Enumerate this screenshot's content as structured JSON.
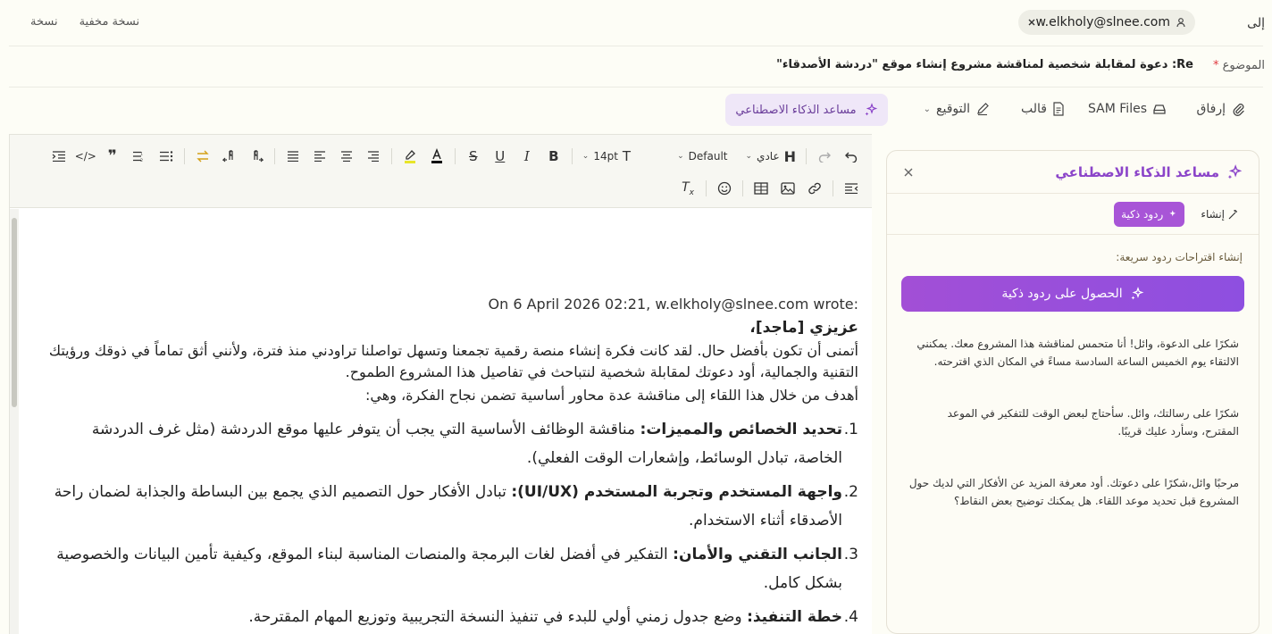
{
  "header": {
    "to_label": "إلى",
    "recipient": "w.elkholy@slnee.com",
    "cc_label": "نسخة",
    "bcc_label": "نسخة مخفية"
  },
  "subject": {
    "label": "الموضوع",
    "required_mark": "*",
    "value": "Re: دعوة لمقابلة شخصية لمناقشة مشروع إنشاء موقع \"دردشة الأصدقاء\""
  },
  "actions": {
    "attach": "إرفاق",
    "sam_files": "SAM Files",
    "template": "قالب",
    "signature": "التوقيع",
    "ai_assistant": "مساعد الذكاء الاصطناعي"
  },
  "toolbar": {
    "heading_style": "عادي",
    "font_family": "Default",
    "font_size": "14pt"
  },
  "body": {
    "quote_header": "On 6 April 2026 02:21, w.elkholy@slnee.com wrote:",
    "greeting": "عزيزي [ماجد]،",
    "intro": "أتمنى أن تكون بأفضل حال. لقد كانت فكرة إنشاء منصة رقمية تجمعنا وتسهل تواصلنا تراودني منذ فترة، ولأنني أثق تماماً في ذوقك ورؤيتك التقنية والجمالية، أود دعوتك لمقابلة شخصية لنتباحث في تفاصيل هذا المشروع الطموح.",
    "purpose": "أهدف من خلال هذا اللقاء إلى مناقشة عدة محاور أساسية تضمن نجاح الفكرة، وهي:",
    "items": [
      {
        "num": "1.",
        "title": "تحديد الخصائص والمميزات:",
        "text": " مناقشة الوظائف الأساسية التي يجب أن يتوفر عليها موقع الدردشة (مثل غرف الدردشة الخاصة، تبادل الوسائط، وإشعارات الوقت الفعلي)."
      },
      {
        "num": "2.",
        "title": "واجهة المستخدم وتجربة المستخدم (UI/UX):",
        "text": " تبادل الأفكار حول التصميم الذي يجمع بين البساطة والجذابة لضمان راحة الأصدقاء أثناء الاستخدام."
      },
      {
        "num": "3.",
        "title": "الجانب التقني والأمان:",
        "text": " التفكير في أفضل لغات البرمجة والمنصات المناسبة لبناء الموقع، وكيفية تأمين البيانات والخصوصية بشكل كامل."
      },
      {
        "num": "4.",
        "title": "خطة التنفيذ:",
        "text": " وضع جدول زمني أولي للبدء في تنفيذ النسخة التجريبية وتوزيع المهام المقترحة."
      }
    ]
  },
  "ai_panel": {
    "title": "مساعد الذكاء الاصطناعي",
    "tab_create": "إنشاء",
    "tab_smart": "ردود ذكية",
    "hint": "إنشاء اقتراحات ردود سريعة:",
    "button": "الحصول على ردود ذكية",
    "suggestions": [
      "شكرًا على الدعوة، وائل! أنا متحمس لمناقشة هذا المشروع معك. يمكنني الالتقاء يوم الخميس الساعة السادسة مساءً في المكان الذي اقترحته.",
      "شكرًا على رسالتك، وائل. سأحتاج لبعض الوقت للتفكير في الموعد المقترح، وسأرد عليك قريبًا.",
      "مرحبًا وائل،شكرًا على دعوتك. أود معرفة المزيد عن الأفكار التي لديك حول المشروع قبل تحديد موعد اللقاء. هل يمكنك توضيح بعض النقاط؟"
    ]
  },
  "colors": {
    "accent": "#a24fd6",
    "ai_text": "#8b44c9",
    "required": "#e0383e"
  }
}
